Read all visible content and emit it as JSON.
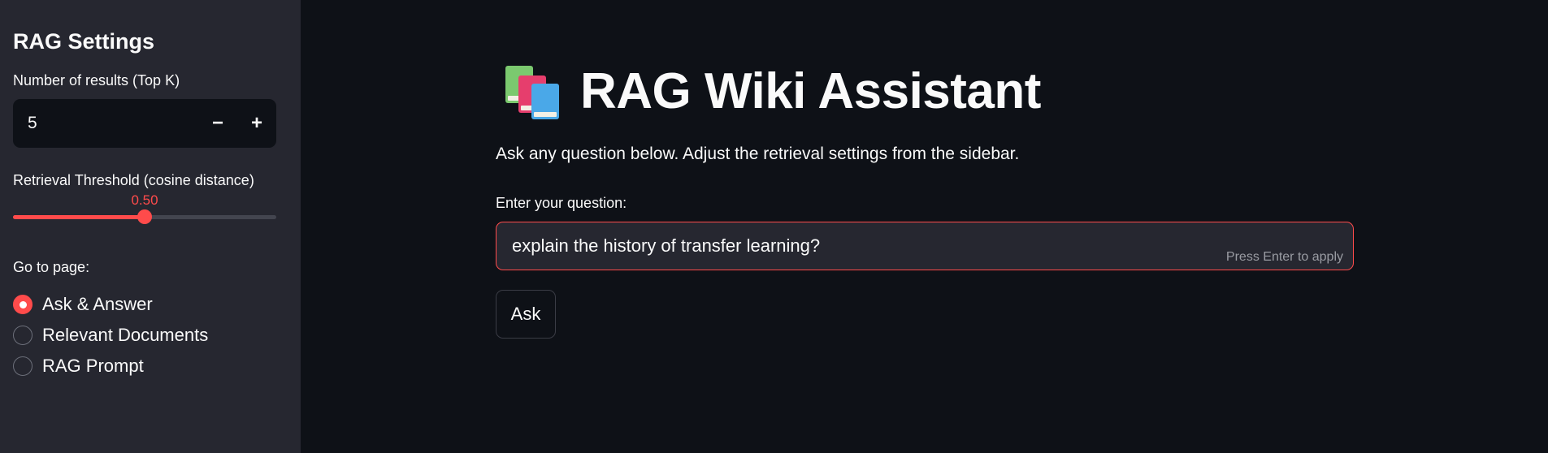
{
  "sidebar": {
    "title": "RAG Settings",
    "top_k": {
      "label": "Number of results (Top K)",
      "value": "5",
      "minus": "−",
      "plus": "+"
    },
    "threshold": {
      "label": "Retrieval Threshold (cosine distance)",
      "value_text": "0.50",
      "fraction": 0.5
    },
    "goto": {
      "label": "Go to page:",
      "options": [
        {
          "label": "Ask & Answer",
          "selected": true
        },
        {
          "label": "Relevant Documents",
          "selected": false
        },
        {
          "label": "RAG Prompt",
          "selected": false
        }
      ]
    }
  },
  "main": {
    "icon": "books-icon",
    "title": "RAG Wiki Assistant",
    "subtitle": "Ask any question below. Adjust the retrieval settings from the sidebar.",
    "question": {
      "label": "Enter your question:",
      "value": "explain the history of transfer learning?",
      "hint": "Press Enter to apply"
    },
    "ask_label": "Ask"
  },
  "colors": {
    "accent": "#ff4b4b",
    "sidebar_bg": "#262730",
    "main_bg": "#0e1117"
  }
}
